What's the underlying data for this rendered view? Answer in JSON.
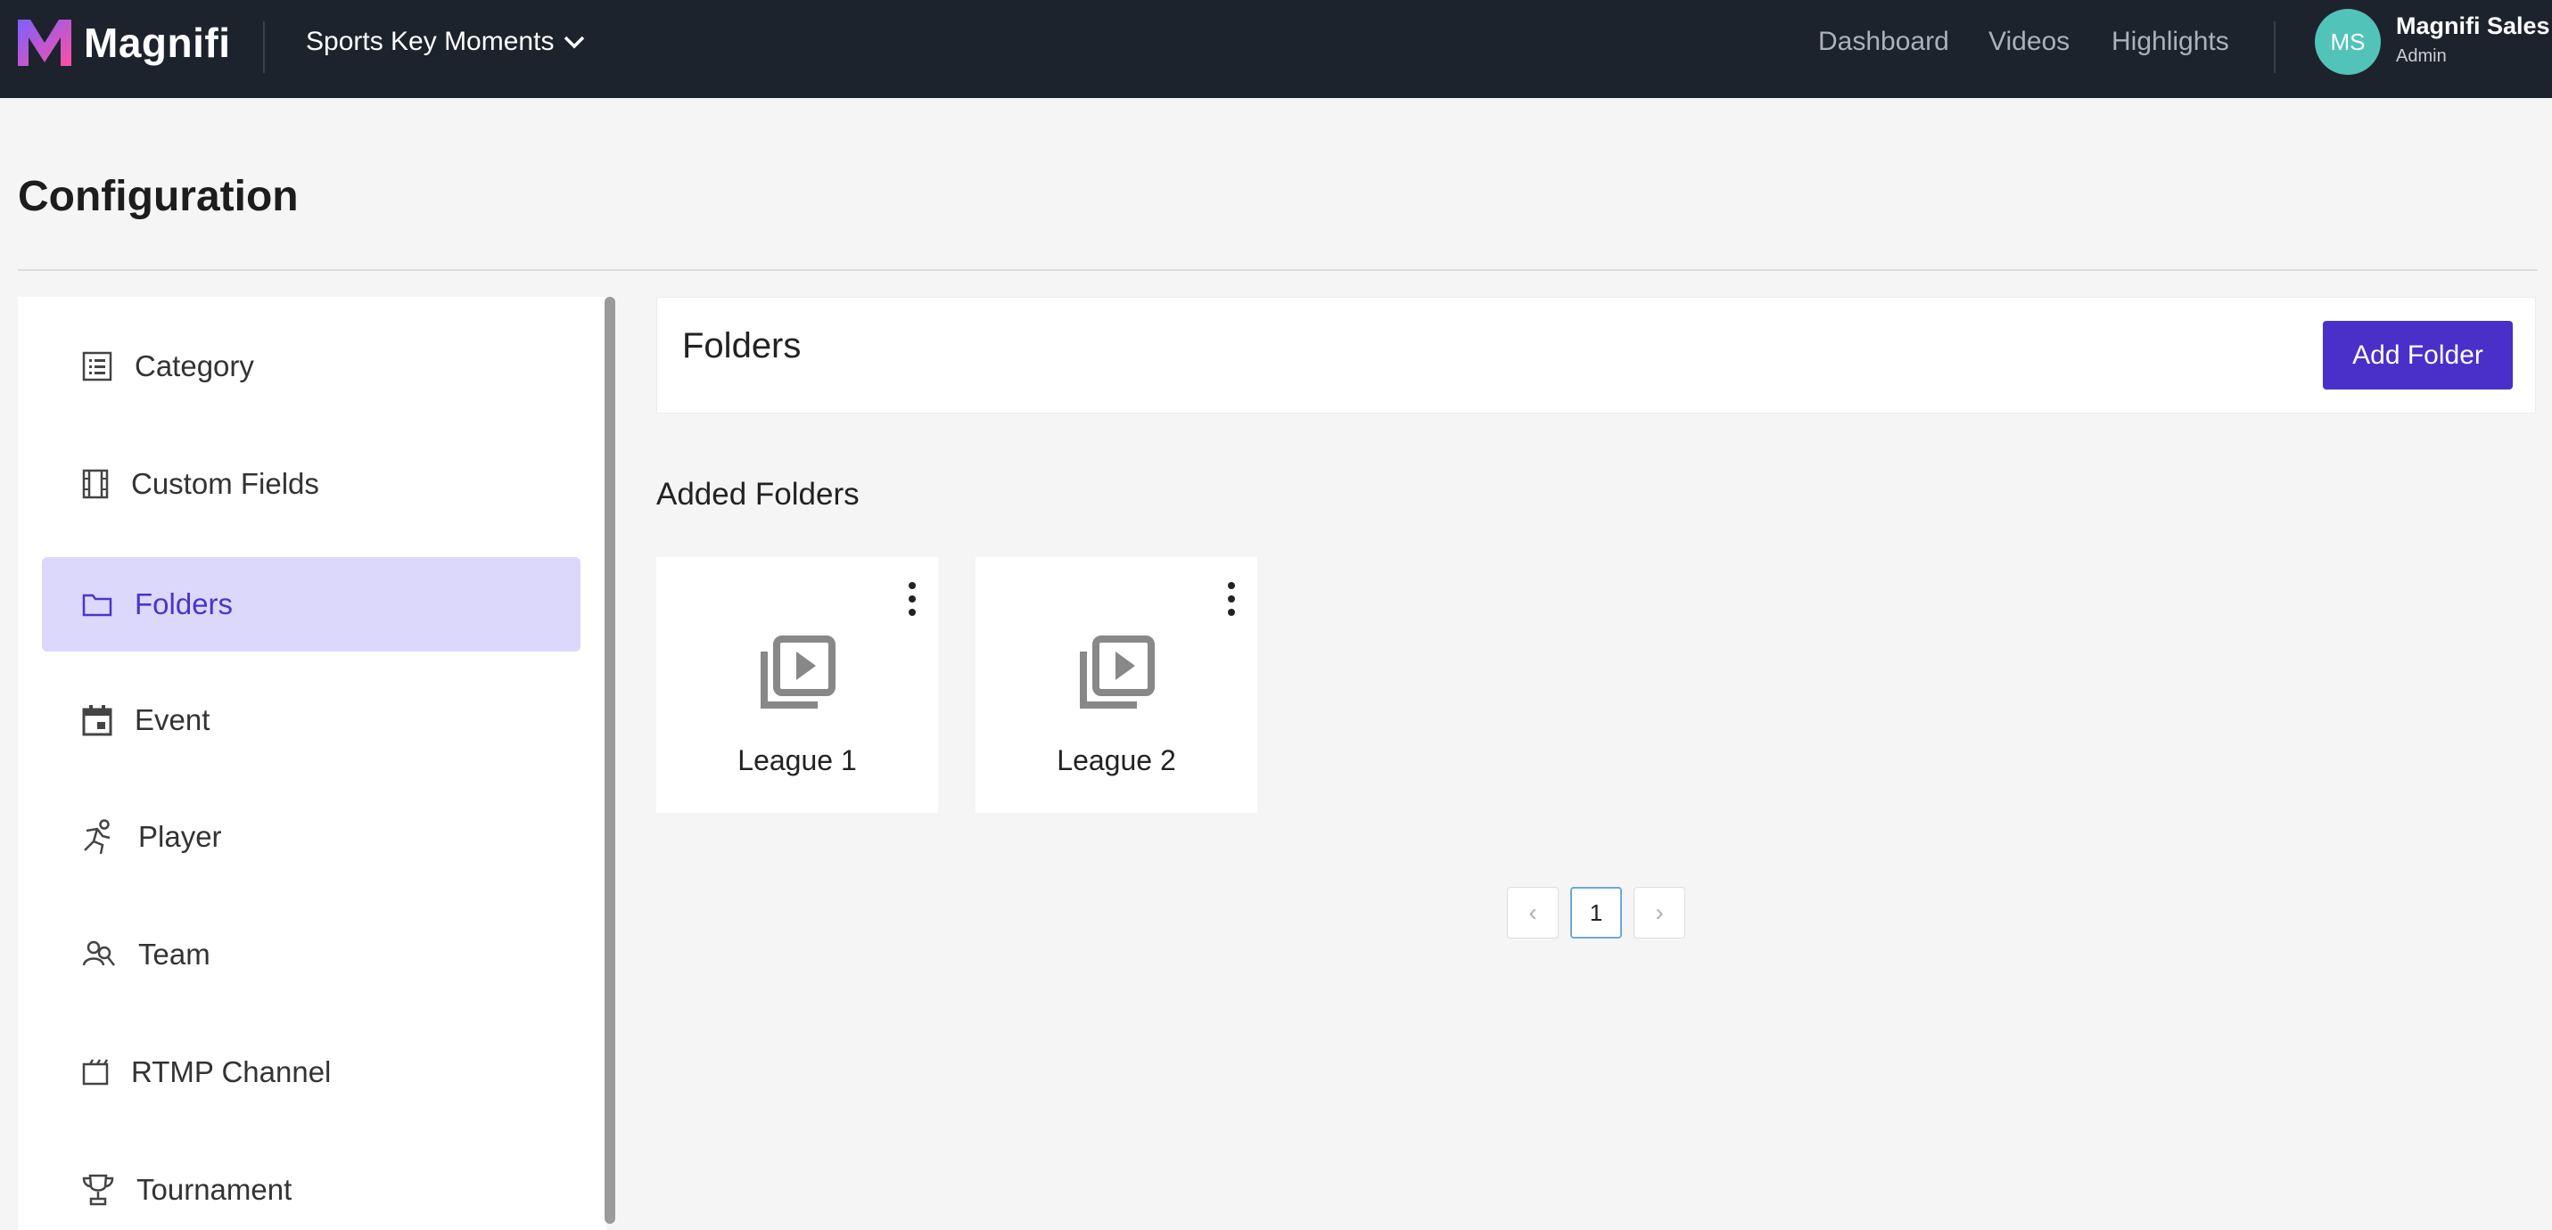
{
  "app": {
    "brand": "Magnifi",
    "project": "Sports Key Moments",
    "nav": [
      "Dashboard",
      "Videos",
      "Highlights"
    ],
    "user": {
      "initials": "MS",
      "name": "Magnifi Sales",
      "role": "Admin"
    }
  },
  "page": {
    "title": "Configuration"
  },
  "sidebar": {
    "items": [
      {
        "label": "Category",
        "icon": "list-icon"
      },
      {
        "label": "Custom Fields",
        "icon": "film-icon"
      },
      {
        "label": "Folders",
        "icon": "folder-icon",
        "active": true
      },
      {
        "label": "Event",
        "icon": "calendar-icon"
      },
      {
        "label": "Player",
        "icon": "player-icon"
      },
      {
        "label": "Team",
        "icon": "team-icon"
      },
      {
        "label": "RTMP Channel",
        "icon": "clapper-icon"
      },
      {
        "label": "Tournament",
        "icon": "trophy-icon"
      }
    ]
  },
  "main": {
    "section_title": "Folders",
    "add_button": "Add Folder",
    "added_title": "Added Folders",
    "folders": [
      {
        "name": "League 1"
      },
      {
        "name": "League 2"
      }
    ],
    "pagination": {
      "prev": "‹",
      "current": "1",
      "next": "›"
    }
  },
  "colors": {
    "topbar": "#1d232c",
    "accent": "#4a2fc9",
    "active_bg": "#dcd8fb",
    "avatar": "#52c3b9"
  }
}
